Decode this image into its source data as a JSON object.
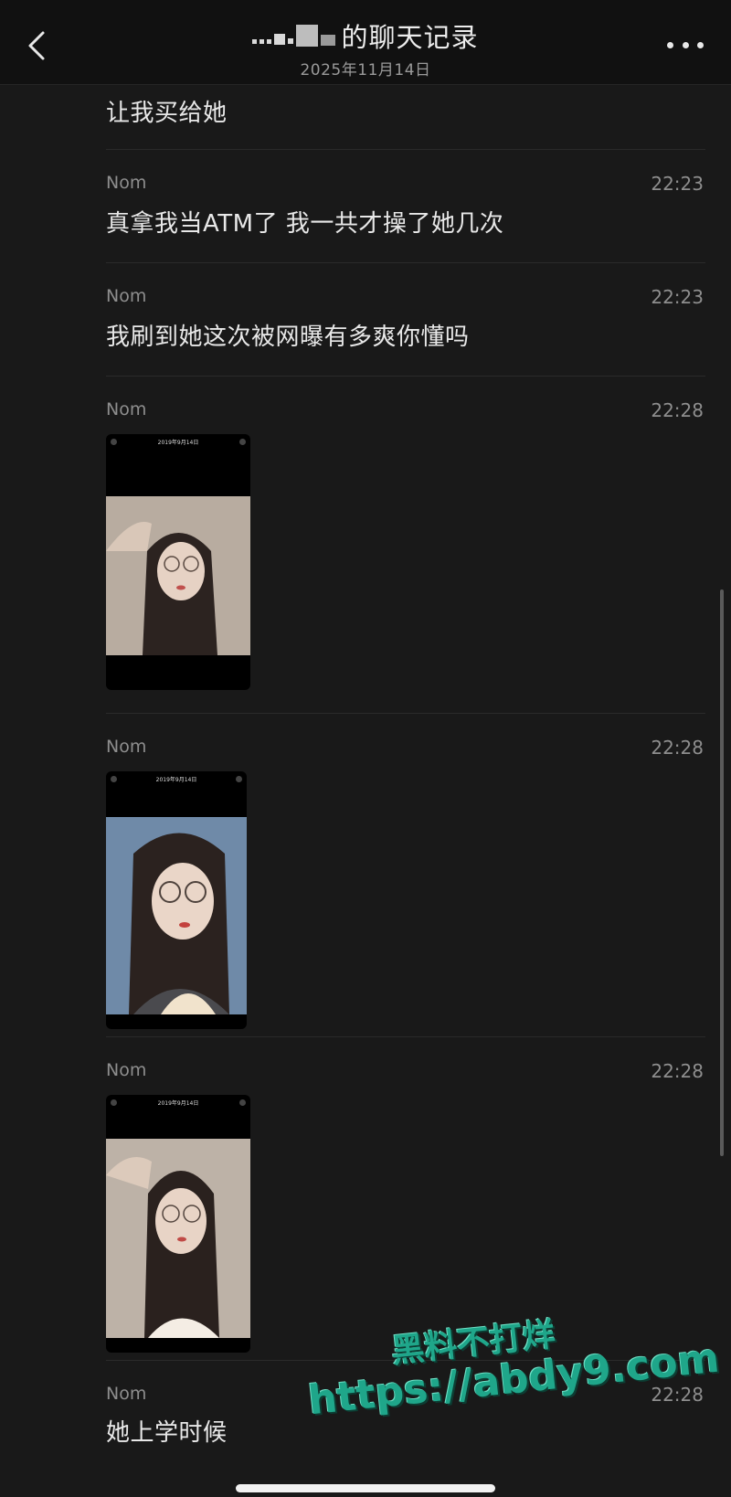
{
  "header": {
    "title": "的聊天记录",
    "subtitle": "2025年11月14日"
  },
  "messages": [
    {
      "text": "让我买给她"
    },
    {
      "sender": "Nom",
      "time": "22:23",
      "text": "真拿我当ATM了 我一共才操了她几次"
    },
    {
      "sender": "Nom",
      "time": "22:23",
      "text": "我刷到她这次被网曝有多爽你懂吗"
    },
    {
      "sender": "Nom",
      "time": "22:28",
      "type": "image",
      "photo_caption": "2019年9月14日"
    },
    {
      "sender": "Nom",
      "time": "22:28",
      "type": "image",
      "photo_caption": "2019年9月14日"
    },
    {
      "sender": "Nom",
      "time": "22:28",
      "type": "image",
      "photo_caption": "2019年9月14日"
    },
    {
      "sender": "Nom",
      "time": "22:28",
      "text": "她上学时候"
    }
  ],
  "watermark": {
    "line1": "黑料不打烊",
    "line2": "https://abdy9.com"
  },
  "colors": {
    "background": "#191919",
    "header": "#111111",
    "watermark": "#1fa68a"
  },
  "icons": [
    "back-arrow-icon",
    "more-dots-icon"
  ]
}
